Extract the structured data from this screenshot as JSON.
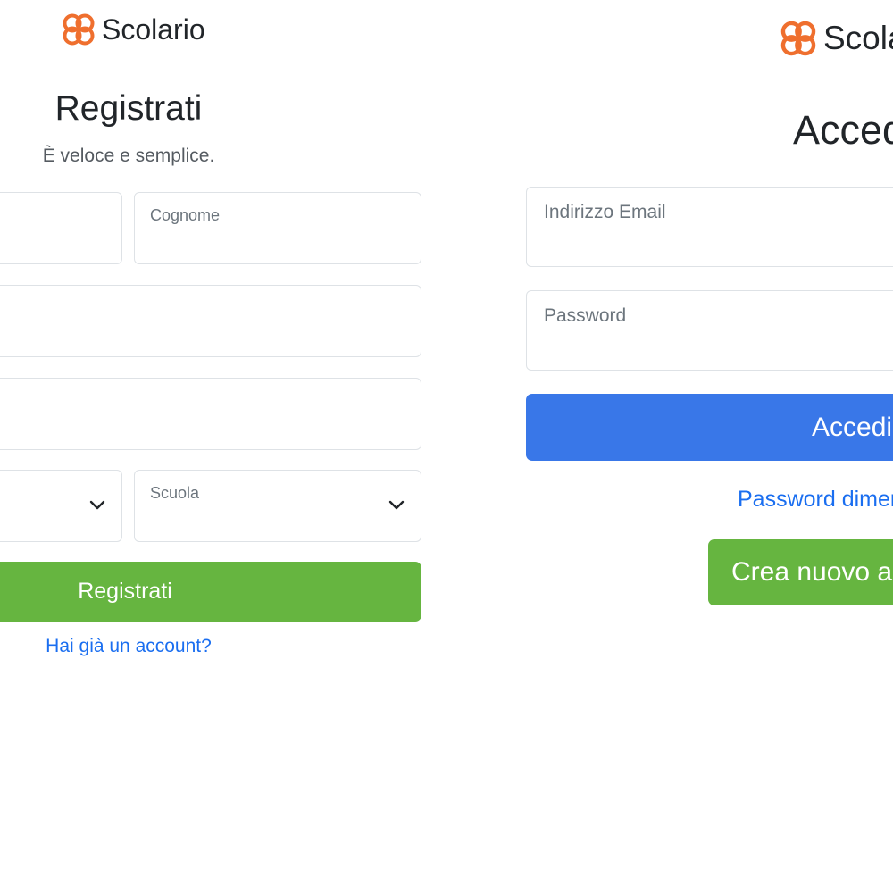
{
  "colors": {
    "logo_orange": "#ef6f2e",
    "register_green": "#66b540",
    "login_blue": "#3977e8",
    "link_blue": "#1a6ef0",
    "field_border": "#dee2e6"
  },
  "register_panel": {
    "logo_text": "Scolario",
    "title": "Registrati",
    "subtitle": "È veloce e semplice.",
    "fields": {
      "first_name_label": "",
      "last_name_label": "Cognome",
      "row2_label": "",
      "row3_label": "",
      "select_left_label": "",
      "school_select_label": "Scuola"
    },
    "icons": {
      "select_chevron": "chevron-down-icon",
      "logo": "scolario-logo-icon"
    },
    "submit_label": "Registrati",
    "login_link": "Hai già un account?"
  },
  "login_panel": {
    "logo_text": "Scola",
    "title": "Acced",
    "email_label": "Indirizzo Email",
    "password_label": "Password",
    "submit_label": "Accedi",
    "forgot_link": "Password dimen",
    "create_account_label": "Crea nuovo a"
  }
}
